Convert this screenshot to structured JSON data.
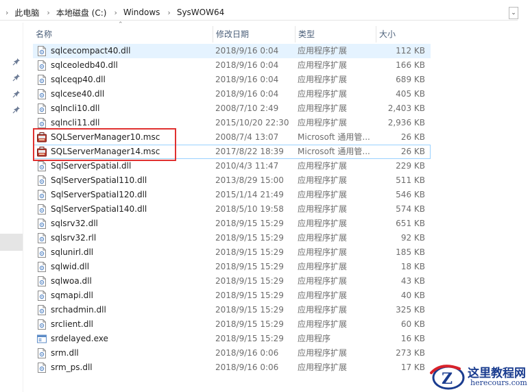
{
  "breadcrumb": [
    "此电脑",
    "本地磁盘 (C:)",
    "Windows",
    "SysWOW64"
  ],
  "columns": {
    "name": "名称",
    "date": "修改日期",
    "type": "类型",
    "size": "大小"
  },
  "files": [
    {
      "name": "sqlcecompact40.dll",
      "date": "2018/9/16 0:04",
      "type": "应用程序扩展",
      "size": "112 KB",
      "icon": "dll-icon"
    },
    {
      "name": "sqlceoledb40.dll",
      "date": "2018/9/16 0:04",
      "type": "应用程序扩展",
      "size": "166 KB",
      "icon": "dll-icon"
    },
    {
      "name": "sqlceqp40.dll",
      "date": "2018/9/16 0:04",
      "type": "应用程序扩展",
      "size": "689 KB",
      "icon": "dll-icon"
    },
    {
      "name": "sqlcese40.dll",
      "date": "2018/9/16 0:04",
      "type": "应用程序扩展",
      "size": "405 KB",
      "icon": "dll-icon"
    },
    {
      "name": "sqlncli10.dll",
      "date": "2008/7/10 2:49",
      "type": "应用程序扩展",
      "size": "2,403 KB",
      "icon": "dll-icon"
    },
    {
      "name": "sqlncli11.dll",
      "date": "2015/10/20 22:30",
      "type": "应用程序扩展",
      "size": "2,936 KB",
      "icon": "dll-icon"
    },
    {
      "name": "SQLServerManager10.msc",
      "date": "2008/7/4 13:07",
      "type": "Microsoft 通用管...",
      "size": "26 KB",
      "icon": "msc-icon"
    },
    {
      "name": "SQLServerManager14.msc",
      "date": "2017/8/22 18:39",
      "type": "Microsoft 通用管...",
      "size": "26 KB",
      "icon": "msc-icon"
    },
    {
      "name": "SqlServerSpatial.dll",
      "date": "2010/4/3 11:47",
      "type": "应用程序扩展",
      "size": "229 KB",
      "icon": "dll-icon"
    },
    {
      "name": "SqlServerSpatial110.dll",
      "date": "2013/8/29 15:00",
      "type": "应用程序扩展",
      "size": "511 KB",
      "icon": "dll-icon"
    },
    {
      "name": "SqlServerSpatial120.dll",
      "date": "2015/1/14 21:49",
      "type": "应用程序扩展",
      "size": "546 KB",
      "icon": "dll-icon"
    },
    {
      "name": "SqlServerSpatial140.dll",
      "date": "2018/5/10 19:58",
      "type": "应用程序扩展",
      "size": "574 KB",
      "icon": "dll-icon"
    },
    {
      "name": "sqlsrv32.dll",
      "date": "2018/9/15 15:29",
      "type": "应用程序扩展",
      "size": "651 KB",
      "icon": "dll-icon"
    },
    {
      "name": "sqlsrv32.rll",
      "date": "2018/9/15 15:29",
      "type": "应用程序扩展",
      "size": "92 KB",
      "icon": "dll-icon"
    },
    {
      "name": "sqlunirl.dll",
      "date": "2018/9/15 15:29",
      "type": "应用程序扩展",
      "size": "185 KB",
      "icon": "dll-icon"
    },
    {
      "name": "sqlwid.dll",
      "date": "2018/9/15 15:29",
      "type": "应用程序扩展",
      "size": "18 KB",
      "icon": "dll-icon"
    },
    {
      "name": "sqlwoa.dll",
      "date": "2018/9/15 15:29",
      "type": "应用程序扩展",
      "size": "43 KB",
      "icon": "dll-icon"
    },
    {
      "name": "sqmapi.dll",
      "date": "2018/9/15 15:29",
      "type": "应用程序扩展",
      "size": "40 KB",
      "icon": "dll-icon"
    },
    {
      "name": "srchadmin.dll",
      "date": "2018/9/15 15:29",
      "type": "应用程序扩展",
      "size": "325 KB",
      "icon": "dll-icon"
    },
    {
      "name": "srclient.dll",
      "date": "2018/9/15 15:29",
      "type": "应用程序扩展",
      "size": "60 KB",
      "icon": "dll-icon"
    },
    {
      "name": "srdelayed.exe",
      "date": "2018/9/15 15:29",
      "type": "应用程序",
      "size": "16 KB",
      "icon": "exe-icon"
    },
    {
      "name": "srm.dll",
      "date": "2018/9/16 0:06",
      "type": "应用程序扩展",
      "size": "273 KB",
      "icon": "dll-icon"
    },
    {
      "name": "srm_ps.dll",
      "date": "2018/9/16 0:06",
      "type": "应用程序扩展",
      "size": "17 KB",
      "icon": "dll-icon"
    }
  ],
  "watermark": {
    "title": "这里教程网",
    "url": "herecours.com"
  }
}
